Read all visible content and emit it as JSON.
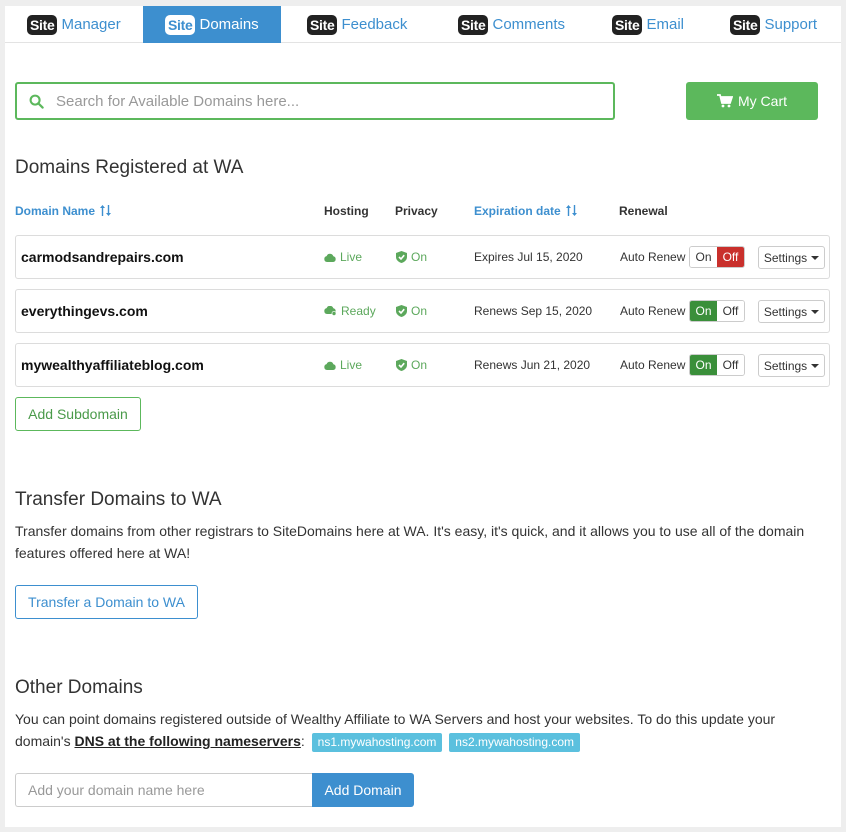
{
  "tabs": [
    {
      "brand": "Site",
      "label": "Manager",
      "active": false
    },
    {
      "brand": "Site",
      "label": "Domains",
      "active": true
    },
    {
      "brand": "Site",
      "label": "Feedback",
      "active": false
    },
    {
      "brand": "Site",
      "label": "Comments",
      "active": false
    },
    {
      "brand": "Site",
      "label": "Email",
      "active": false
    },
    {
      "brand": "Site",
      "label": "Support",
      "active": false
    }
  ],
  "search": {
    "placeholder": "Search for Available Domains here...",
    "value": ""
  },
  "cart": {
    "label": "My Cart",
    "icon": "cart-icon"
  },
  "registered": {
    "title": "Domains Registered at WA",
    "headers": {
      "domain": "Domain Name",
      "hosting": "Hosting",
      "privacy": "Privacy",
      "expiration": "Expiration date",
      "renewal": "Renewal"
    },
    "rows": [
      {
        "domain": "carmodsandrepairs.com",
        "hosting": "Live",
        "privacy": "On",
        "expiration": "Expires Jul 15, 2020",
        "auto_renew_label": "Auto Renew",
        "auto_renew": "Off"
      },
      {
        "domain": "everythingevs.com",
        "hosting": "Ready",
        "privacy": "On",
        "expiration": "Renews Sep 15, 2020",
        "auto_renew_label": "Auto Renew",
        "auto_renew": "On"
      },
      {
        "domain": "mywealthyaffiliateblog.com",
        "hosting": "Live",
        "privacy": "On",
        "expiration": "Renews Jun 21, 2020",
        "auto_renew_label": "Auto Renew",
        "auto_renew": "On"
      }
    ],
    "toggle_on": "On",
    "toggle_off": "Off",
    "settings_label": "Settings",
    "add_subdomain": "Add Subdomain"
  },
  "transfer": {
    "title": "Transfer Domains to WA",
    "text": "Transfer domains from other registrars to SiteDomains here at WA. It's easy, it's quick, and it allows you to use all of the domain features offered here at WA!",
    "button": "Transfer a Domain to WA"
  },
  "other": {
    "title": "Other Domains",
    "text_before": "You can point domains registered outside of Wealthy Affiliate to WA Servers and host your websites. To do this update your domain's",
    "dns_link": "DNS at the following nameservers",
    "colon": ":",
    "ns1": "ns1.mywahosting.com",
    "ns2": "ns2.mywahosting.com",
    "input_placeholder": "Add your domain name here",
    "add_button": "Add Domain"
  },
  "colors": {
    "accent": "#3d8fcf",
    "success": "#5cb85c",
    "danger": "#c9302c",
    "info": "#5bc0de"
  }
}
